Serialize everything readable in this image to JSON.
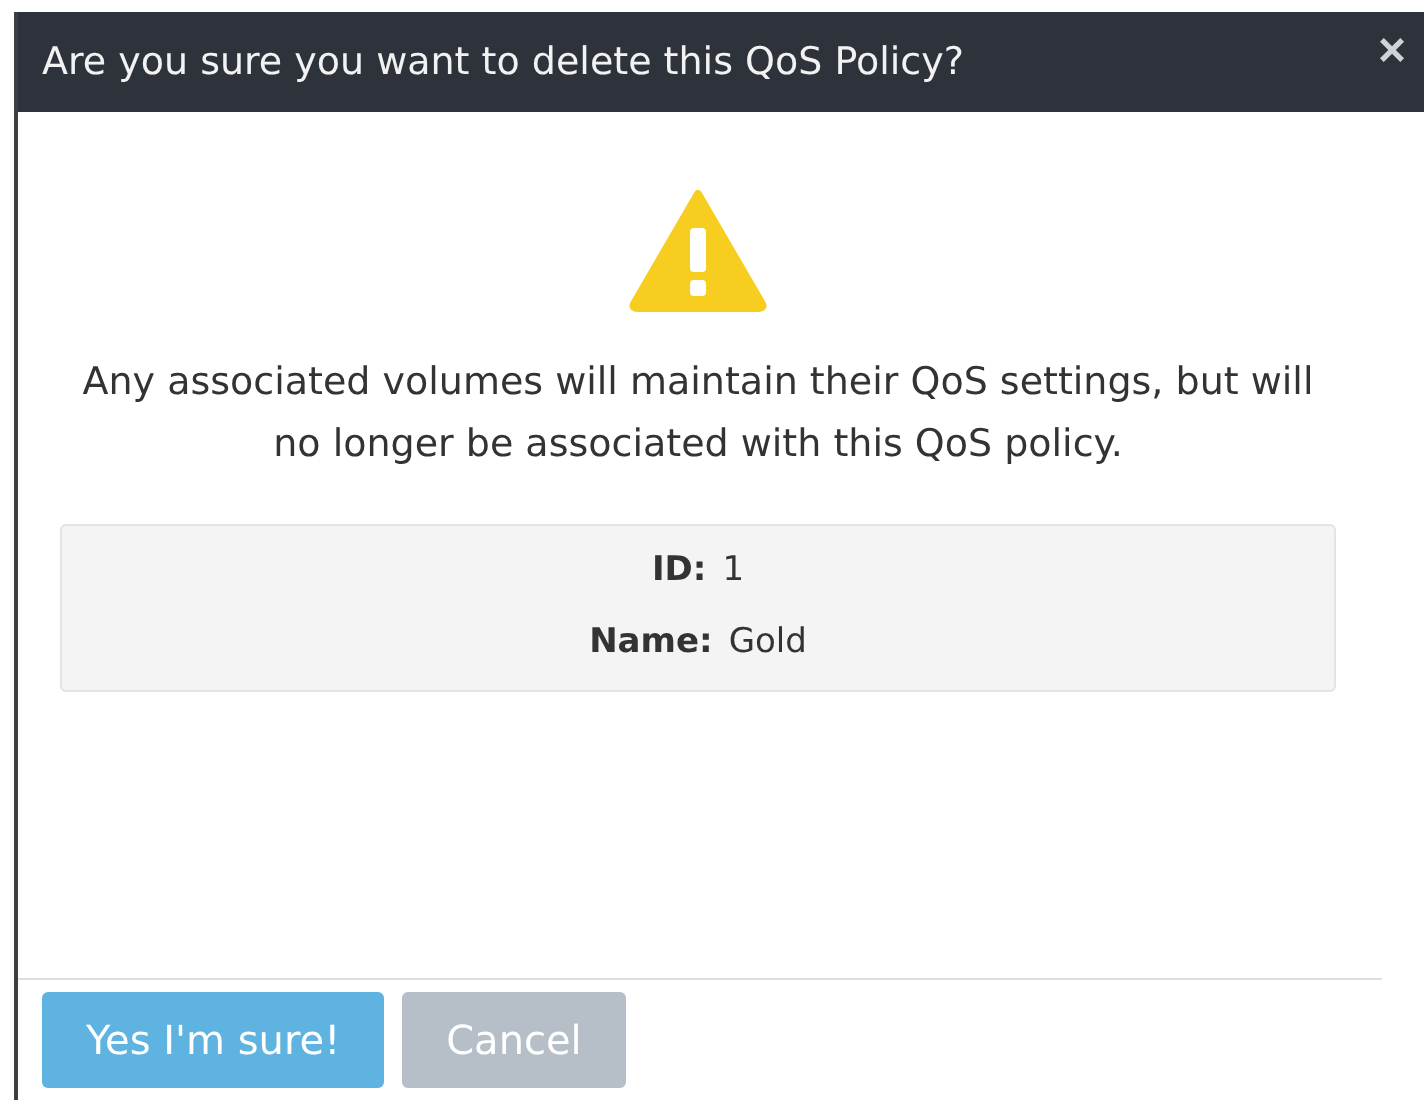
{
  "dialog": {
    "title": "Are you sure you want to delete this QoS Policy?",
    "close": "×",
    "message": "Any associated volumes will maintain their QoS settings, but will no longer be associated with this QoS policy.",
    "details": [
      {
        "label": "ID:",
        "value": "1"
      },
      {
        "label": "Name:",
        "value": "Gold"
      }
    ],
    "buttons": [
      {
        "label": "Yes I'm sure!",
        "kind": "primary"
      },
      {
        "label": "Cancel",
        "kind": "secondary"
      }
    ]
  }
}
